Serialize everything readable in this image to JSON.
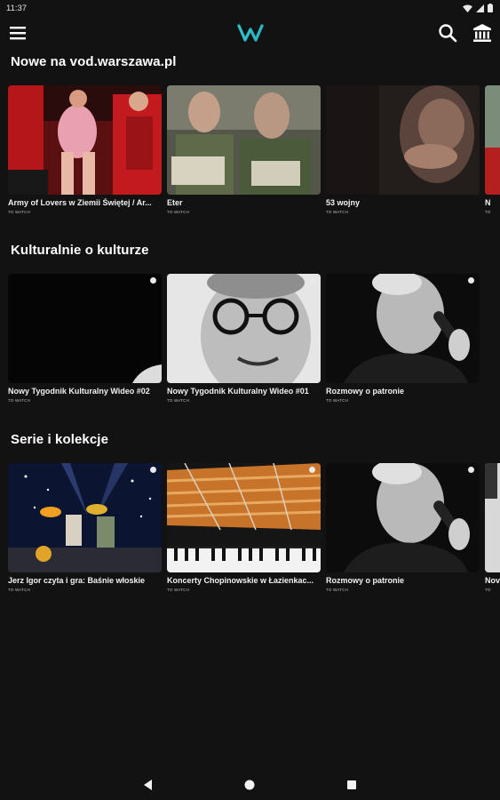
{
  "status": {
    "time": "11:37"
  },
  "icons": {
    "menu": "hamburger-menu-icon",
    "logo": "w-logo-icon",
    "search": "search-icon",
    "museum": "museum-icon"
  },
  "colors": {
    "background": "#121212",
    "accent": "#2bb3c0",
    "text": "#ffffff"
  },
  "sections": [
    {
      "title": "Nowe na vod.warszawa.pl",
      "items": [
        {
          "title": "Army of Lovers w Ziemii Świętej / Ar...",
          "sub": "TO WATCH"
        },
        {
          "title": "Eter",
          "sub": "TO WATCH"
        },
        {
          "title": "53 wojny",
          "sub": "TO WATCH"
        },
        {
          "title": "N",
          "sub": "TO"
        }
      ]
    },
    {
      "title": "Kulturalnie o kulturze",
      "items": [
        {
          "title": "Nowy Tygodnik Kulturalny Wideo #02",
          "sub": "TO WATCH"
        },
        {
          "title": "Nowy Tygodnik Kulturalny Wideo #01",
          "sub": "TO WATCH"
        },
        {
          "title": "Rozmowy o patronie",
          "sub": "TO WATCH"
        }
      ]
    },
    {
      "title": "Serie i kolekcje",
      "items": [
        {
          "title": "Jerz Igor czyta i gra: Baśnie włoskie",
          "sub": "TO WATCH"
        },
        {
          "title": "Koncerty Chopinowskie w Łazienkac...",
          "sub": "TO WATCH"
        },
        {
          "title": "Rozmowy o patronie",
          "sub": "TO WATCH"
        },
        {
          "title": "Nov",
          "sub": "TO"
        }
      ]
    }
  ]
}
